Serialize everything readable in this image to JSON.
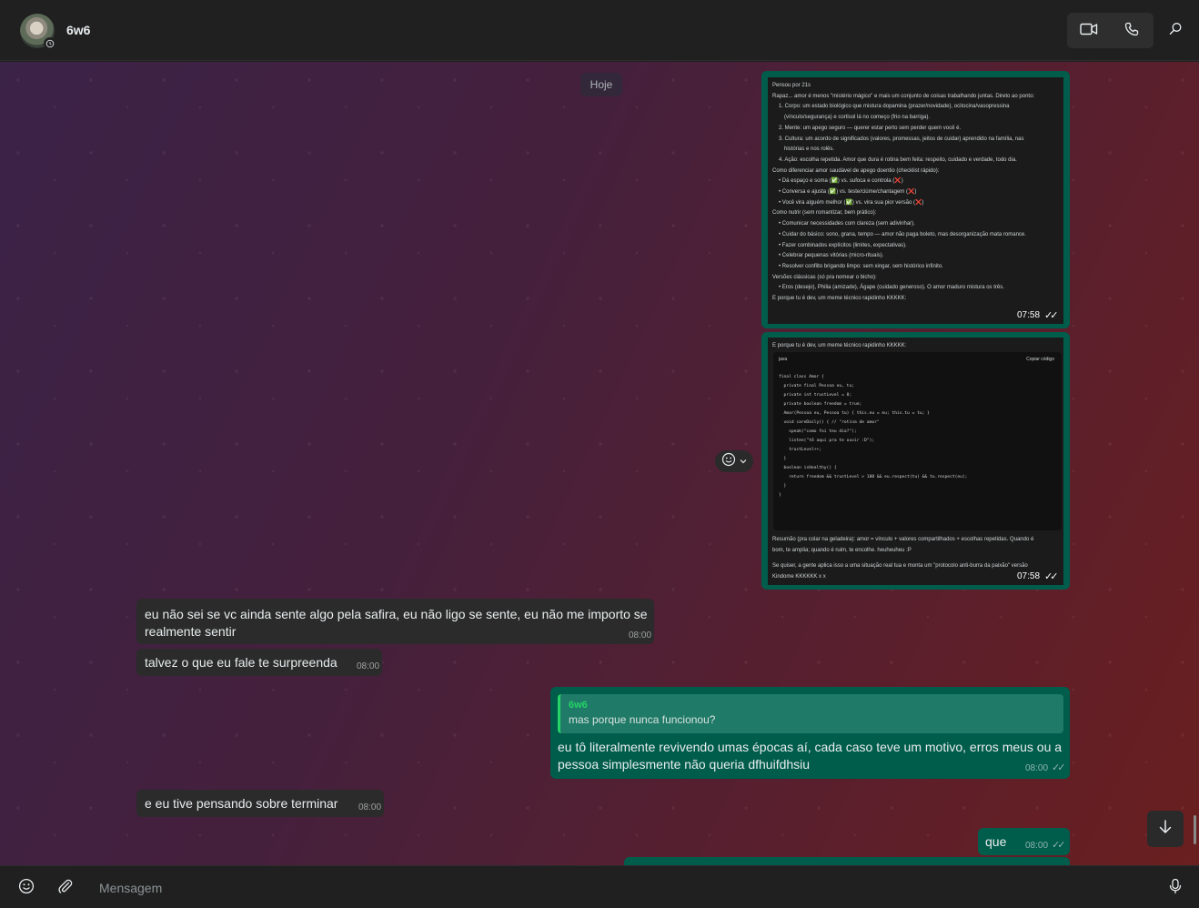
{
  "header": {
    "contact_name": "6w6",
    "icons": [
      "avatar",
      "status-icon",
      "video-call-icon",
      "voice-call-icon",
      "search-icon"
    ]
  },
  "chat": {
    "date_divider": "Hoje",
    "image1": {
      "lines": [
        "Pensou por 21s",
        "Rapaz... amor é menos \"mistério mágico\" e mais um conjunto de coisas trabalhando juntas. Direto ao ponto:",
        "1.  Corpo: um estado biológico que mistura dopamina (prazer/novidade), ocitocina/vasopressina",
        "(vínculo/segurança) e cortisol lá no começo (frio na barriga).",
        "2.  Mente: um apego seguro — querer estar perto sem perder quem você é.",
        "3.  Cultura: um acordo de significados (valores, promessas, jeitos de cuidar) aprendido na família, nas",
        "histórias e nos rolês.",
        "4.  Ação: escolha repetida. Amor que dura é rotina bem feita: respeito, cuidado e verdade, todo dia.",
        "Como diferenciar amor saudável de apego doentio (checklist rápido):",
        "•  Dá espaço e soma (✅) vs. sufoca e controla (❌)",
        "•  Conversa e ajusta (✅) vs. teste/ciúme/chantagem (❌)",
        "•  Você vira alguém melhor (✅) vs. vira sua pior versão (❌)",
        "Como nutrir (sem romantizar, bem prático):",
        "•  Comunicar necessidades com clareza (sem adivinhar).",
        "•  Cuidar do básico: sono, grana, tempo — amor não paga boleto, mas desorganização mata romance.",
        "•  Fazer combinados explícitos (limites, expectativas).",
        "•  Celebrar pequenas vitórias (micro-rituais).",
        "•  Resolver conflito brigando limpo: sem xingar, sem histórico infinito.",
        "Versões clássicas (só pra nomear o bicho):",
        "•  Eros (desejo), Philia (amizade), Ágape (cuidado generoso). O amor maduro mistura os três.",
        "E porque tu é dev, um meme técnico rapidinho KKKKK:"
      ],
      "time": "07:58"
    },
    "image2": {
      "header_line": "E porque tu é dev, um meme técnico rapidinho KKKKK:",
      "code_lang": "java",
      "copy_label": "Copiar código",
      "code_lines": [
        "final class Amor {",
        "  private final Pessoa eu, tu;",
        "  private int trustLevel = 0;",
        "  private boolean freedom = true;",
        "",
        "  Amor(Pessoa eu, Pessoa tu) { this.eu = eu; this.tu = tu; }",
        "",
        "  void careDaily() { // \"rotina de amor\"",
        "    speak(\"como foi teu dia?\");",
        "    listen(\"tô aqui pra te ouvir :D\");",
        "    trustLevel++;",
        "  }",
        "",
        "  boolean isHealthy() {",
        "    return freedom && trustLevel > 100 && eu.respect(tu) && tu.respect(eu);",
        "  }",
        "}"
      ],
      "footer_lines": [
        "Resumão (pra colar na geladeira): amor = vínculo + valores compartilhados + escolhas repetidas. Quando é",
        "bom, te amplia; quando é ruim, te encolhe. heuheuheu :P",
        "",
        "Se quiser, a gente aplica isso a uma situação real tua e monta um \"protocolo anti-burra da paixão\" versão",
        "Kindome KKKKKK x x"
      ],
      "time": "07:58"
    },
    "messages": [
      {
        "dir": "in",
        "text_line1": "eu não sei se vc ainda sente algo pela safira, eu não ligo se sente, eu não me importo se",
        "text_line2": "realmente sentir",
        "time": "08:00"
      },
      {
        "dir": "in",
        "text": "talvez o que eu fale te surpreenda",
        "time": "08:00"
      },
      {
        "dir": "out",
        "quote_author": "6w6",
        "quote_text": "mas porque nunca funcionou?",
        "text_line1": "eu tô literalmente revivendo umas épocas aí, cada caso teve um motivo, erros meus ou a",
        "text_line2": "pessoa simplesmente não queria dfhuifdhsiu",
        "time": "08:00"
      },
      {
        "dir": "in",
        "text": "e eu tive pensando sobre terminar",
        "time": "08:00"
      },
      {
        "dir": "out",
        "text": "que",
        "time": "08:00"
      }
    ]
  },
  "composer": {
    "placeholder": "Mensagem",
    "icons": [
      "emoji-icon",
      "attach-icon",
      "microphone-icon"
    ]
  },
  "colors": {
    "header_bg": "#202020",
    "outgoing_bubble": "#005c4b",
    "incoming_bubble": "#2b2b2b",
    "accent": "#25d366"
  }
}
